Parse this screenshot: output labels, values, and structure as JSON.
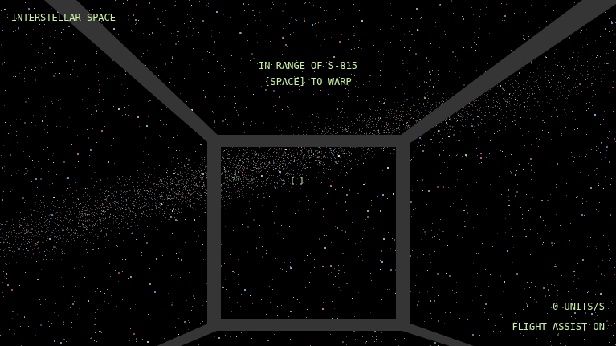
{
  "location": "INTERSTELLAR SPACE",
  "prompt": {
    "lines": [
      "IN RANGE OF S-815",
      "[SPACE] TO WARP"
    ]
  },
  "speed": "0 UNITS/S",
  "flight_assist": "FLIGHT ASSIST ON"
}
